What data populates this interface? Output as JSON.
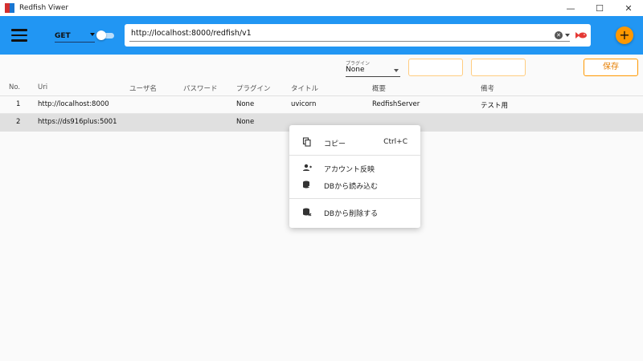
{
  "window": {
    "title": "Redfish Viwer",
    "minimize": "—",
    "maximize": "☐",
    "close": "✕"
  },
  "appbar": {
    "method": "GET",
    "url": "http://localhost:8000/redfish/v1",
    "add_label": "+"
  },
  "filters": {
    "plugin_caption": "プラグイン",
    "plugin_value": "None",
    "save_label": "保存"
  },
  "table": {
    "columns": [
      "No.",
      "Uri",
      "ユーザ名",
      "パスワード",
      "プラグイン",
      "タイトル",
      "概要",
      "備考"
    ],
    "rows": [
      {
        "no": "1",
        "uri": "http://localhost:8000",
        "user": "",
        "password": "",
        "plugin": "None",
        "title": "uvicorn",
        "summary": "RedfishServer",
        "note": "テスト用"
      },
      {
        "no": "2",
        "uri": "https://ds916plus:5001",
        "user": "",
        "password": "",
        "plugin": "None",
        "title": "",
        "summary": "",
        "note": ""
      }
    ]
  },
  "context_menu": {
    "items": [
      {
        "label": "コピー",
        "shortcut": "Ctrl+C",
        "icon": "copy-icon"
      },
      {
        "label": "アカウント反映",
        "shortcut": "",
        "icon": "account-icon"
      },
      {
        "label": "DBから読み込む",
        "shortcut": "",
        "icon": "db-load-icon"
      },
      {
        "label": "DBから削除する",
        "shortcut": "",
        "icon": "db-delete-icon"
      }
    ]
  },
  "colors": {
    "appbar": "#2196f3",
    "accent": "#ff9800",
    "send_icon": "#e53935"
  }
}
